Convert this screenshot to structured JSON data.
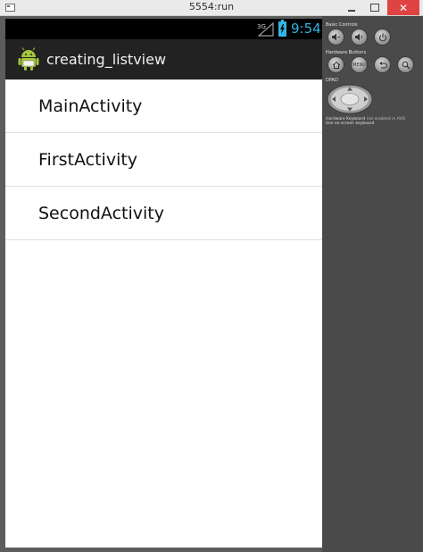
{
  "window": {
    "title": "5554:run"
  },
  "statusbar": {
    "network": "3G",
    "time": "9:54",
    "accent_color": "#33b5e5"
  },
  "actionbar": {
    "app_title": "creating_listview"
  },
  "list": {
    "items": [
      {
        "label": "MainActivity"
      },
      {
        "label": "FirstActivity"
      },
      {
        "label": "SecondActivity"
      }
    ]
  },
  "panel": {
    "basic_controls_label": "Basic Controls",
    "hardware_buttons_label": "Hardware Buttons",
    "dpad_label": "DPAD",
    "menu_label": "MENU",
    "keyboard_hint_bold": "Hardware Keyboard",
    "keyboard_hint_rest": " not enabled in AVD",
    "keyboard_hint_line2": "Use on-screen keyboard"
  }
}
